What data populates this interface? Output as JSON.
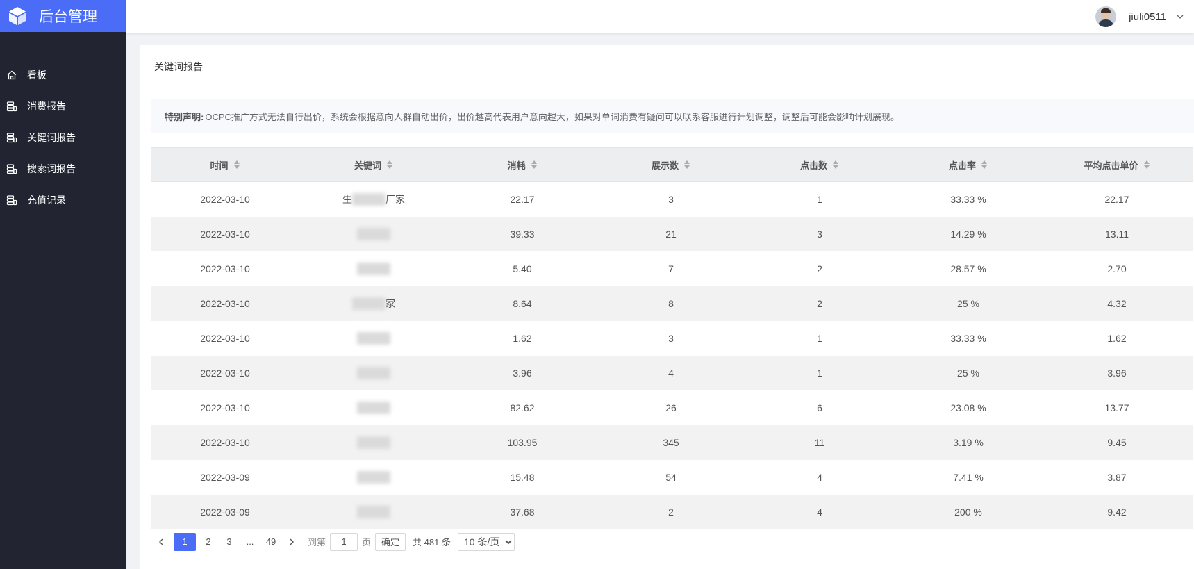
{
  "app": {
    "title": "后台管理"
  },
  "sidebar": {
    "items": [
      {
        "label": "看板",
        "icon": "home-icon"
      },
      {
        "label": "消费报告",
        "icon": "database-icon"
      },
      {
        "label": "关键词报告",
        "icon": "database-icon"
      },
      {
        "label": "搜索词报告",
        "icon": "database-icon"
      },
      {
        "label": "充值记录",
        "icon": "database-icon"
      }
    ]
  },
  "header": {
    "username": "jiuli0511"
  },
  "page": {
    "title": "关键词报告"
  },
  "notice": {
    "label": "特别声明:",
    "text": "OCPC推广方式无法自行出价，系统会根据意向人群自动出价，出价越高代表用户意向越大，如果对单词消费有疑问可以联系客服进行计划调整，调整后可能会影响计划展现。"
  },
  "table": {
    "columns": [
      "时间",
      "关键词",
      "消耗",
      "展示数",
      "点击数",
      "点击率",
      "平均点击单价"
    ],
    "rows": [
      {
        "date": "2022-03-10",
        "keyword": "生",
        "keyword_end": "厂家",
        "cost": "22.17",
        "impressions": "3",
        "clicks": "1",
        "ctr": "33.33 %",
        "cpc": "22.17"
      },
      {
        "date": "2022-03-10",
        "keyword": "",
        "keyword_end": "",
        "cost": "39.33",
        "impressions": "21",
        "clicks": "3",
        "ctr": "14.29 %",
        "cpc": "13.11"
      },
      {
        "date": "2022-03-10",
        "keyword": "",
        "keyword_end": "",
        "cost": "5.40",
        "impressions": "7",
        "clicks": "2",
        "ctr": "28.57 %",
        "cpc": "2.70"
      },
      {
        "date": "2022-03-10",
        "keyword": "",
        "keyword_end": "家",
        "cost": "8.64",
        "impressions": "8",
        "clicks": "2",
        "ctr": "25 %",
        "cpc": "4.32"
      },
      {
        "date": "2022-03-10",
        "keyword": "",
        "keyword_end": "",
        "cost": "1.62",
        "impressions": "3",
        "clicks": "1",
        "ctr": "33.33 %",
        "cpc": "1.62"
      },
      {
        "date": "2022-03-10",
        "keyword": "",
        "keyword_end": "",
        "cost": "3.96",
        "impressions": "4",
        "clicks": "1",
        "ctr": "25 %",
        "cpc": "3.96"
      },
      {
        "date": "2022-03-10",
        "keyword": "",
        "keyword_end": "",
        "cost": "82.62",
        "impressions": "26",
        "clicks": "6",
        "ctr": "23.08 %",
        "cpc": "13.77"
      },
      {
        "date": "2022-03-10",
        "keyword": "",
        "keyword_end": "",
        "cost": "103.95",
        "impressions": "345",
        "clicks": "11",
        "ctr": "3.19 %",
        "cpc": "9.45"
      },
      {
        "date": "2022-03-09",
        "keyword": "",
        "keyword_end": "",
        "cost": "15.48",
        "impressions": "54",
        "clicks": "4",
        "ctr": "7.41 %",
        "cpc": "3.87"
      },
      {
        "date": "2022-03-09",
        "keyword": "",
        "keyword_end": "",
        "cost": "37.68",
        "impressions": "2",
        "clicks": "4",
        "ctr": "200 %",
        "cpc": "9.42"
      }
    ]
  },
  "pagination": {
    "pages": [
      "1",
      "2",
      "3"
    ],
    "ellipsis": "...",
    "last": "49",
    "goto_label": "到第",
    "goto_value": "1",
    "page_suffix": "页",
    "confirm": "确定",
    "total": "共 481 条",
    "page_size": "10 条/页"
  },
  "colors": {
    "sidebar_bg": "#222531",
    "accent": "#4a6cf7"
  }
}
